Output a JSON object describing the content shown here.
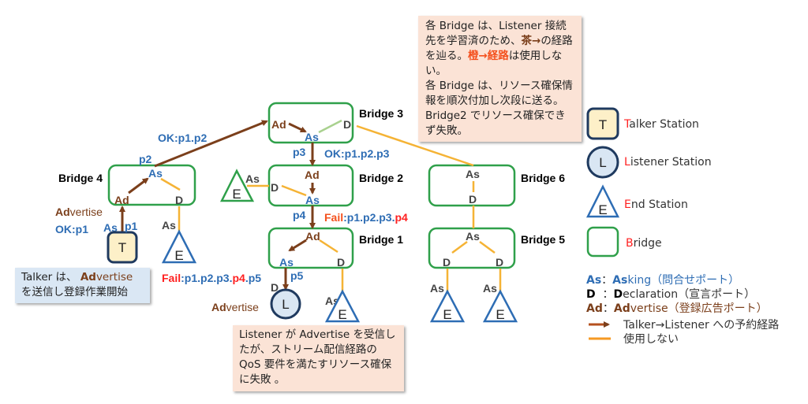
{
  "colors": {
    "reserve_path": "#7B3F1B",
    "unused_path": "#F5B335",
    "bridge": "#2FA04A",
    "asking": "#2E6DB4",
    "fail": "#FF2020",
    "callout_orange": "#FBE3D6",
    "callout_blue": "#DAE7F4"
  },
  "bridges": {
    "b1": "Bridge 1",
    "b2": "Bridge 2",
    "b3": "Bridge 3",
    "b4": "Bridge 4",
    "b5": "Bridge 5",
    "b6": "Bridge 6"
  },
  "ports": {
    "as": "As",
    "ad": "Ad",
    "d": "D"
  },
  "stations": {
    "t": "T",
    "l": "L",
    "e": "E"
  },
  "labels": {
    "ok_p1p2": "OK:p1.p2",
    "p1": "p1",
    "p2": "p2",
    "p3": "p3",
    "p4": "p4",
    "p5": "p5",
    "adv_ad": "Ad",
    "adv_rest": "vertise",
    "ok_p1": "OK:p1",
    "ok_p1p2p3": "OK:p1.p2.p3",
    "fail": "Fail",
    "fail_b2_mid": ":p1.p2.p3.",
    "fail_b2_p4": "p4",
    "fail_l_mid": ":p1.p2.p3.",
    "fail_l_p4": "p4",
    "fail_l_end": ".p5"
  },
  "callouts": {
    "top": {
      "l1": "各 Bridge は、Listener 接続先を学習済のため、",
      "brown": "茶→",
      "l2": "の経路を辿る。",
      "orange": "橙→経路",
      "l3": "は使用しない。",
      "l4": "各 Bridge は、リソース確保情報を順次付加し次段に送る。Bridge2 でリソース確保できず失敗。"
    },
    "talker": {
      "pre": "Talker は、 ",
      "ad": "Ad",
      "rest": "vertise",
      "l2": "を送信し登録作業開始"
    },
    "listener": {
      "text": "Listener が Advertise を受信したが、ストリーム配信経路の QoS 要件を満たすリソース確保に失敗 。"
    }
  },
  "legend": {
    "talker": {
      "first": "T",
      "rest": "alker Station"
    },
    "listener": {
      "first": "L",
      "rest": "istener Station"
    },
    "end": {
      "first": "E",
      "rest": "nd Station"
    },
    "bridge": {
      "first": "B",
      "rest": "ridge"
    },
    "as": {
      "abbr": "As",
      "sep": "：",
      "bold": "As",
      "rest": "king（問合せポート）"
    },
    "d": {
      "abbr": "D",
      "sep": "  ：",
      "bold": "D",
      "rest": "eclaration（宣言ポート）"
    },
    "ad": {
      "abbr": "Ad",
      "sep": "：",
      "bold": "Ad",
      "rest": "vertise（登録広告ポート）"
    },
    "arrow": "Talker→Listener への予約経路",
    "line": "使用しない"
  }
}
